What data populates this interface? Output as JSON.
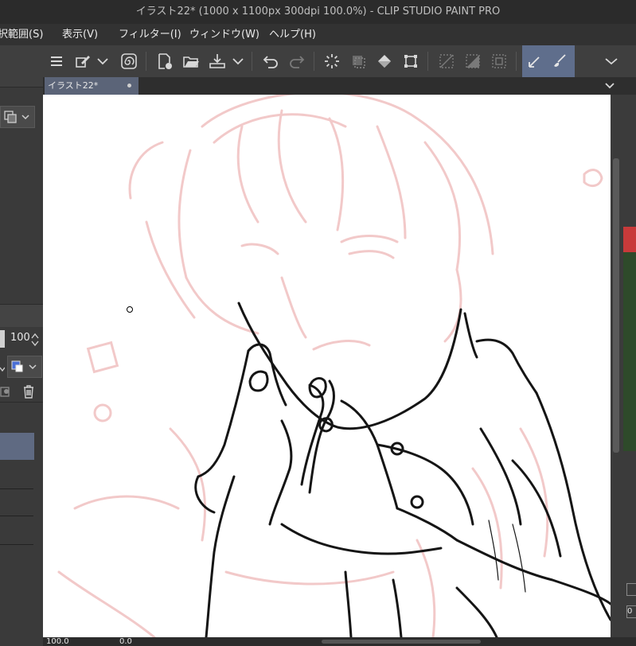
{
  "window": {
    "title": "イラスト22* (1000 x 1100px 300dpi 100.0%)  - CLIP STUDIO PAINT PRO"
  },
  "menu": {
    "items": [
      {
        "id": "select",
        "label": "択範囲(S)"
      },
      {
        "id": "view",
        "label": "表示(V)"
      },
      {
        "id": "filter",
        "label": "フィルター(I)"
      },
      {
        "id": "window",
        "label": "ウィンドウ(W)"
      },
      {
        "id": "help",
        "label": "ヘルプ(H)"
      }
    ]
  },
  "toolbar": {
    "icons": [
      "menu-icon",
      "edit-icon",
      "chevron-down-icon",
      "spiral-icon",
      "new-icon",
      "open-icon",
      "save-icon",
      "chevron-down-icon",
      "undo-icon",
      "redo-icon",
      "loading-icon",
      "transform-icon",
      "fill-icon",
      "crop-icon",
      "clear-selection-icon",
      "invert-selection-icon",
      "selection-border-icon",
      "pen-icon",
      "brush-icon",
      "chevron-down-icon"
    ]
  },
  "tab": {
    "label": "イラスト22*"
  },
  "left_panel": {
    "opacity_value": "100",
    "accent_color": "#4a6fd6"
  },
  "status": {
    "zoom": "100.0",
    "angle": "0.0",
    "right_value": "0"
  },
  "colors": {
    "sketch": "#f2c9c9",
    "line": "#151515",
    "canvas": "#ffffff",
    "tab_active": "#5b6478",
    "tool_active": "#5f6e8c"
  }
}
